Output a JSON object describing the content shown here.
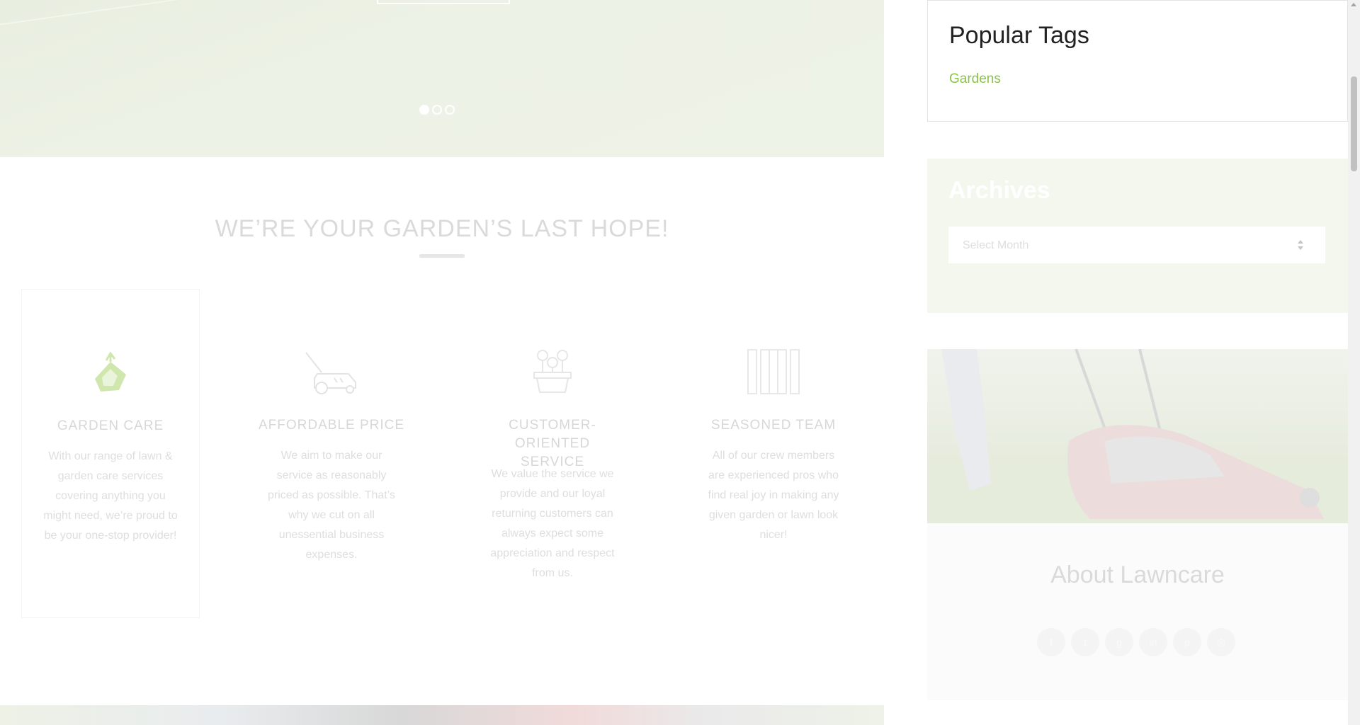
{
  "hero": {
    "slides": [
      {
        "active": true
      },
      {
        "active": false
      },
      {
        "active": false
      }
    ]
  },
  "intro": {
    "headline": "WE’RE YOUR GARDEN’S LAST HOPE!"
  },
  "features": [
    {
      "icon": "garden-care-icon",
      "title": "GARDEN CARE",
      "text": "With our range of lawn & garden care services covering anything you might need, we’re proud to be your one-stop provider!"
    },
    {
      "icon": "lawn-mower-icon",
      "title": "AFFORDABLE PRICE",
      "text": "We aim to make our service as reasonably priced as possible. That’s why we cut on all unessential business expenses."
    },
    {
      "icon": "flower-pot-icon",
      "title": "CUSTOMER-ORIENTED SERVICE",
      "text": "We value the service we provide and our loyal returning customers can always expect some appreciation and respect from us."
    },
    {
      "icon": "fence-icon",
      "title": "SEASONED TEAM",
      "text": "All of our crew members are experienced pros who find real joy in making any given garden or lawn look nicer!"
    }
  ],
  "sidebar": {
    "tags": {
      "title": "Popular Tags",
      "items": [
        "Gardens"
      ]
    },
    "archives": {
      "title": "Archives",
      "select_placeholder": "Select Month"
    },
    "about": {
      "title": "About Lawncare",
      "socials": [
        "facebook-icon",
        "twitter-icon",
        "google-plus-icon",
        "linkedin-icon",
        "pinterest-icon",
        "instagram-icon"
      ]
    }
  },
  "colors": {
    "accent": "#8bc34a",
    "archives_bg": "#f3f7ed"
  }
}
